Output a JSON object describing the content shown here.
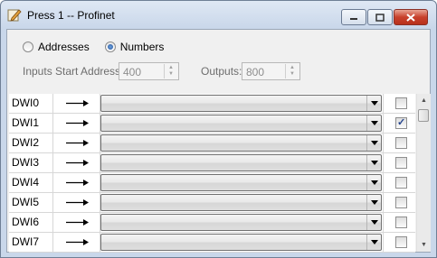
{
  "window": {
    "title": "Press 1 -- Profinet",
    "icon": "app-pencil-icon",
    "controls": {
      "minimize": "minimize-icon",
      "maximize": "maximize-icon",
      "close": "close-icon"
    }
  },
  "mode": {
    "options": [
      {
        "label": "Addresses",
        "selected": false
      },
      {
        "label": "Numbers",
        "selected": true
      }
    ]
  },
  "inputs_start": {
    "label": "Inputs Start Address:",
    "value": "400"
  },
  "outputs": {
    "label": "Outputs:",
    "value": "800"
  },
  "rows": [
    {
      "name": "DWI0",
      "checked": false
    },
    {
      "name": "DWI1",
      "checked": true
    },
    {
      "name": "DWI2",
      "checked": false
    },
    {
      "name": "DWI3",
      "checked": false
    },
    {
      "name": "DWI4",
      "checked": false
    },
    {
      "name": "DWI5",
      "checked": false
    },
    {
      "name": "DWI6",
      "checked": false
    },
    {
      "name": "DWI7",
      "checked": false
    }
  ],
  "colors": {
    "titlebar": "#c9d7ea",
    "client": "#f0f0f0",
    "close_button": "#c8412c",
    "check_mark": "#25458e"
  }
}
